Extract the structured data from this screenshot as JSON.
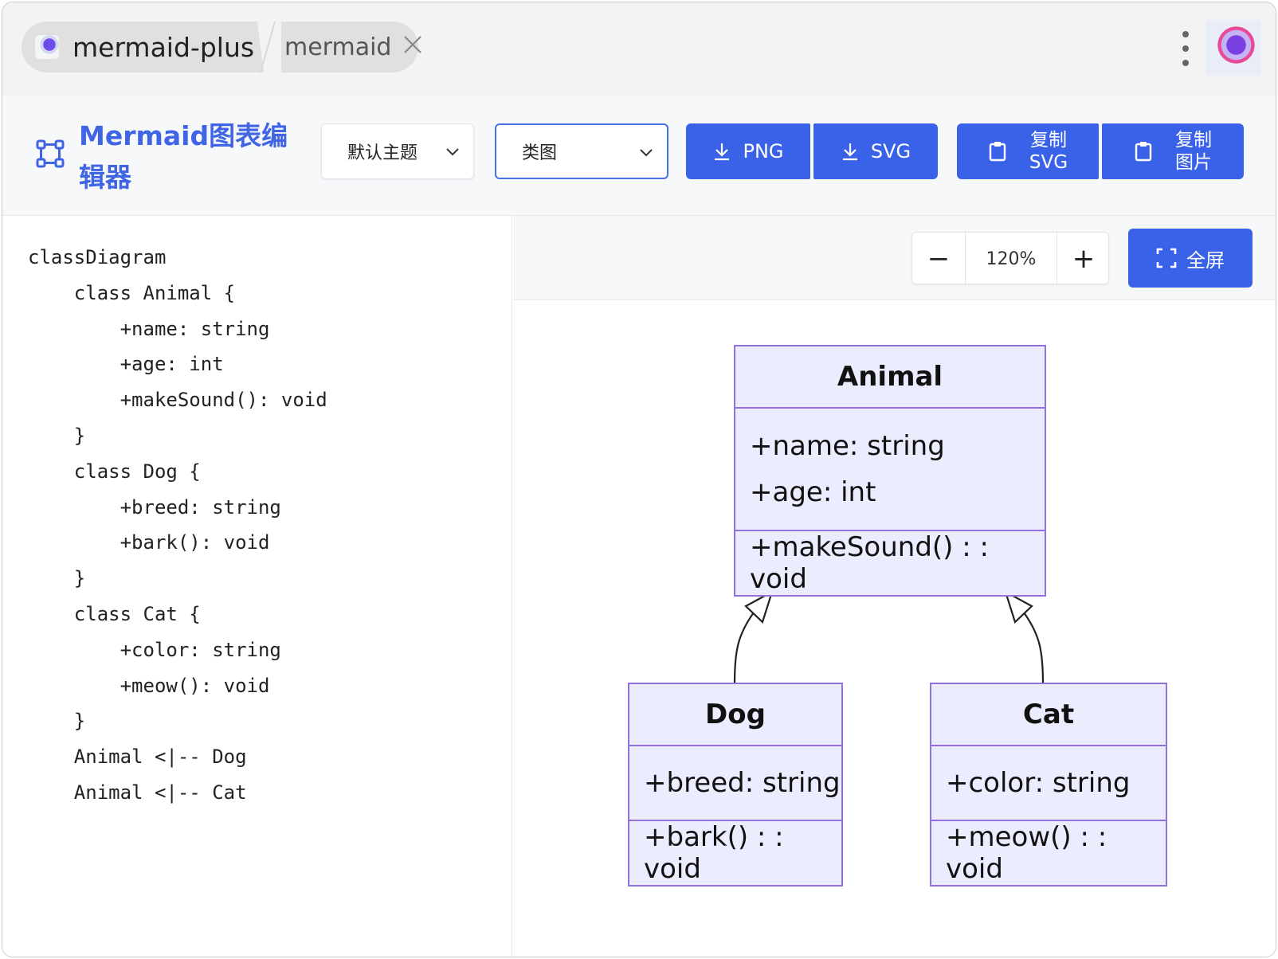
{
  "tabs": {
    "active_label": "mermaid-plus",
    "inactive_label": "mermaid",
    "favicon": "mermaid-plus-favicon",
    "close_icon": "close-icon"
  },
  "toolbar": {
    "app_title": "Mermaid图表编辑器",
    "theme_select_value": "默认主题",
    "type_select_value": "类图",
    "btn_png": "PNG",
    "btn_svg": "SVG",
    "btn_copy_svg_line1": "复制",
    "btn_copy_svg_line2": "SVG",
    "btn_copy_img_line1": "复制",
    "btn_copy_img_line2": "图片",
    "accent_color": "#3a62e8"
  },
  "editor": {
    "lines": [
      "classDiagram",
      "    class Animal {",
      "        +name: string",
      "        +age: int",
      "        +makeSound(): void",
      "    }",
      "    class Dog {",
      "        +breed: string",
      "        +bark(): void",
      "    }",
      "    class Cat {",
      "        +color: string",
      "        +meow(): void",
      "    }",
      "    Animal <|-- Dog",
      "    Animal <|-- Cat"
    ]
  },
  "preview": {
    "zoom_level": "120%",
    "zoom_minus": "−",
    "zoom_plus": "+",
    "fullscreen_label": "全屏",
    "diagram": {
      "fill_color": "#ececff",
      "border_color": "#9370db",
      "classes": [
        {
          "name": "Animal",
          "attributes": [
            "+name: string",
            "+age: int"
          ],
          "methods": [
            "+makeSound() : : void"
          ]
        },
        {
          "name": "Dog",
          "attributes": [
            "+breed: string"
          ],
          "methods": [
            "+bark() : : void"
          ]
        },
        {
          "name": "Cat",
          "attributes": [
            "+color: string"
          ],
          "methods": [
            "+meow() : : void"
          ]
        }
      ],
      "relations": [
        {
          "from": "Dog",
          "to": "Animal",
          "type": "inheritance"
        },
        {
          "from": "Cat",
          "to": "Animal",
          "type": "inheritance"
        }
      ]
    }
  }
}
